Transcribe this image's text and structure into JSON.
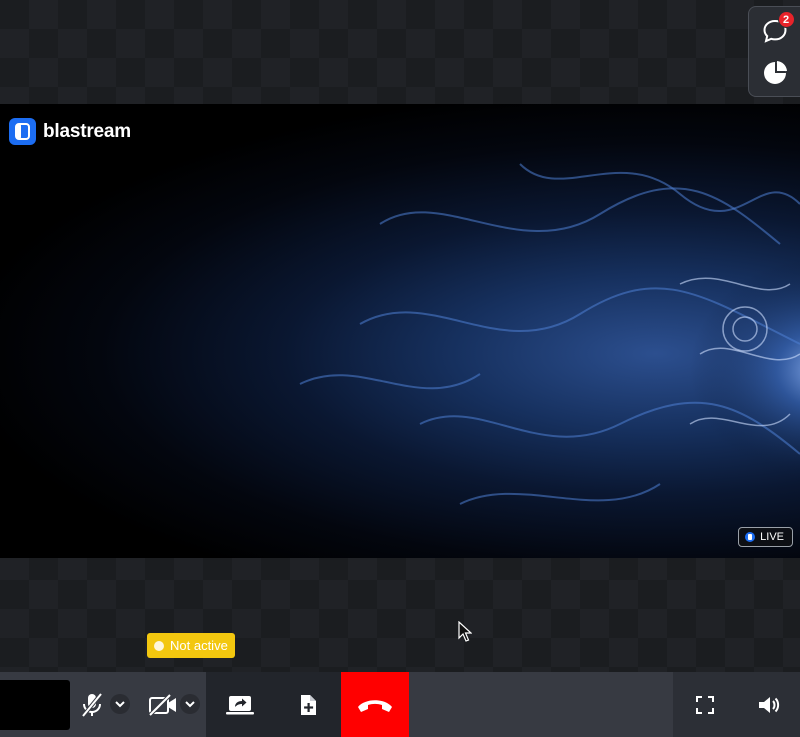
{
  "brand": {
    "name": "blastream"
  },
  "side_panel": {
    "chat_badge_count": "2"
  },
  "stage": {
    "live_label": "LIVE"
  },
  "status": {
    "label": "Not active"
  },
  "colors": {
    "brand_blue": "#1c6df2",
    "end_call_red": "#ff0000",
    "status_yellow": "#f3c70f",
    "badge_red": "#e8232a"
  },
  "icons": {
    "chat": "chat-bubble-icon",
    "stats": "pie-chart-icon",
    "mic": "mic-off-icon",
    "camera": "camera-off-icon",
    "share": "share-screen-icon",
    "add_file": "add-file-icon",
    "end_call": "hang-up-icon",
    "fullscreen": "fullscreen-icon",
    "volume": "volume-icon"
  }
}
